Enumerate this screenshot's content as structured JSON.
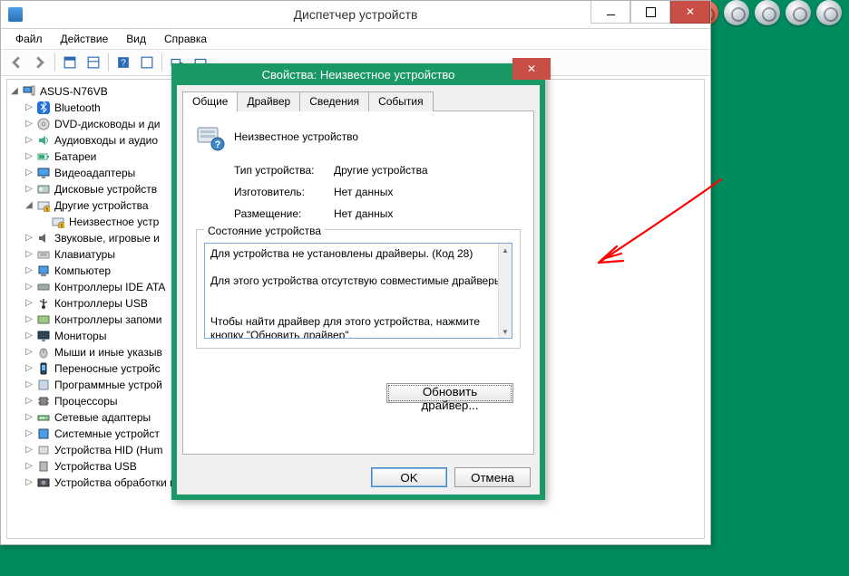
{
  "dm": {
    "title": "Диспетчер устройств",
    "menu": [
      "Файл",
      "Действие",
      "Вид",
      "Справка"
    ],
    "root": "ASUS-N76VB",
    "nodes": [
      {
        "label": "Bluetooth",
        "icon": "bluetooth",
        "exp": ">"
      },
      {
        "label": "DVD-дисководы и ди",
        "icon": "disc",
        "exp": ">"
      },
      {
        "label": "Аудиовходы и аудио",
        "icon": "audio",
        "exp": ">"
      },
      {
        "label": "Батареи",
        "icon": "battery",
        "exp": ">"
      },
      {
        "label": "Видеоадаптеры",
        "icon": "display",
        "exp": ">"
      },
      {
        "label": "Дисковые устройств",
        "icon": "hdd",
        "exp": ">"
      },
      {
        "label": "Другие устройства",
        "icon": "other",
        "exp": "v",
        "children": [
          {
            "label": "Неизвестное устр",
            "icon": "unknown"
          }
        ]
      },
      {
        "label": "Звуковые, игровые и",
        "icon": "sound",
        "exp": ">"
      },
      {
        "label": "Клавиатуры",
        "icon": "keyboard",
        "exp": ">"
      },
      {
        "label": "Компьютер",
        "icon": "computer",
        "exp": ">"
      },
      {
        "label": "Контроллеры IDE ATA",
        "icon": "ide",
        "exp": ">"
      },
      {
        "label": "Контроллеры USB",
        "icon": "usb",
        "exp": ">"
      },
      {
        "label": "Контроллеры запоми",
        "icon": "storage",
        "exp": ">"
      },
      {
        "label": "Мониторы",
        "icon": "monitor",
        "exp": ">"
      },
      {
        "label": "Мыши и иные указыв",
        "icon": "mouse",
        "exp": ">"
      },
      {
        "label": "Переносные устройс",
        "icon": "portable",
        "exp": ">"
      },
      {
        "label": "Программные устрой",
        "icon": "soft",
        "exp": ">"
      },
      {
        "label": "Процессоры",
        "icon": "cpu",
        "exp": ">"
      },
      {
        "label": "Сетевые адаптеры",
        "icon": "net",
        "exp": ">"
      },
      {
        "label": "Системные устройст",
        "icon": "system",
        "exp": ">"
      },
      {
        "label": "Устройства HID (Hum",
        "icon": "hid",
        "exp": ">"
      },
      {
        "label": "Устройства USB",
        "icon": "usb2",
        "exp": ">"
      },
      {
        "label": "Устройства обработки изображений",
        "icon": "image",
        "exp": ">"
      }
    ]
  },
  "props": {
    "title": "Свойства: Неизвестное устройство",
    "tabs": [
      "Общие",
      "Драйвер",
      "Сведения",
      "События"
    ],
    "device_name": "Неизвестное устройство",
    "rows": {
      "type_k": "Тип устройства:",
      "type_v": "Другие устройства",
      "mfg_k": "Изготовитель:",
      "mfg_v": "Нет данных",
      "loc_k": "Размещение:",
      "loc_v": "Нет данных"
    },
    "status_legend": "Состояние устройства",
    "status_text": "Для устройства не установлены драйверы. (Код 28)\n\nДля этого устройства отсутствую совместимые драйверы.\n\n\nЧтобы найти драйвер для этого устройства, нажмите кнопку \"Обновить драйвер\".",
    "update_btn": "Обновить драйвер...",
    "ok": "OK",
    "cancel": "Отмена"
  }
}
